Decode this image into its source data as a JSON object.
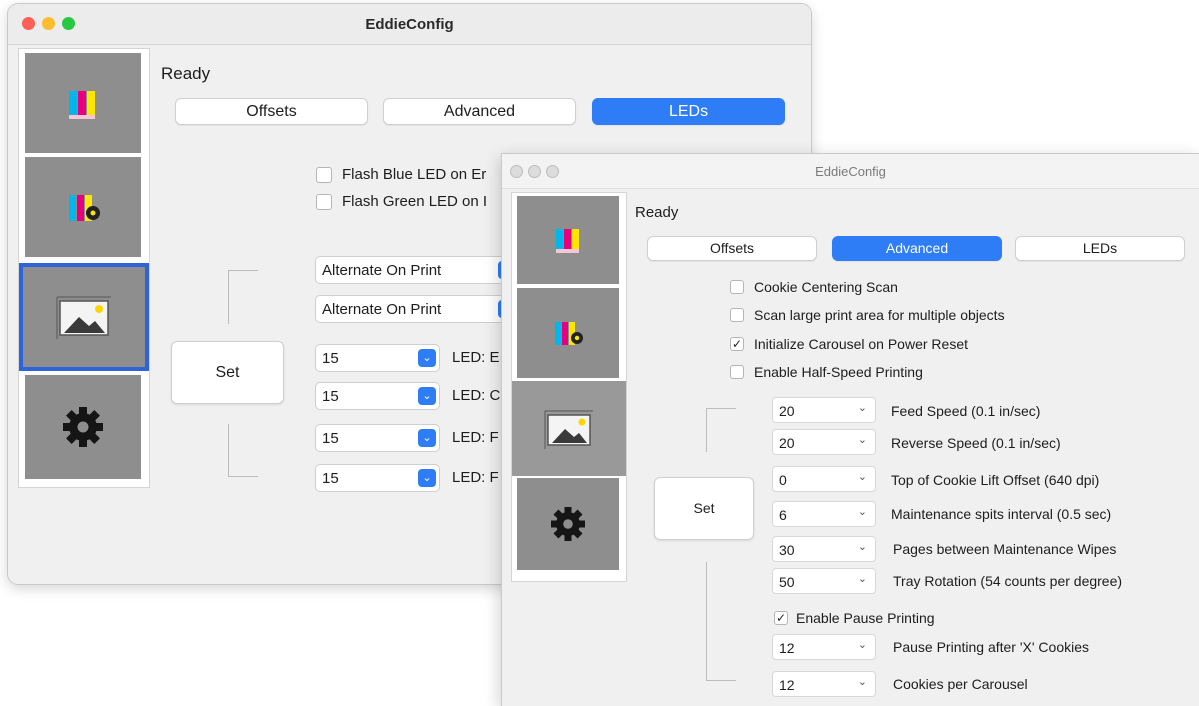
{
  "back_window": {
    "title": "EddieConfig",
    "status": "Ready",
    "tabs": [
      {
        "label": "Offsets",
        "active": false
      },
      {
        "label": "Advanced",
        "active": false
      },
      {
        "label": "LEDs",
        "active": true
      }
    ],
    "sidebar": [
      {
        "name": "color-bars-icon",
        "selected": false
      },
      {
        "name": "color-settings-icon",
        "selected": false
      },
      {
        "name": "print-area-icon",
        "selected": true
      },
      {
        "name": "gear-icon",
        "selected": false
      }
    ],
    "checkboxes": [
      {
        "label": "Flash Blue LED on Er",
        "checked": false
      },
      {
        "label": "Flash Green LED on I",
        "checked": false
      }
    ],
    "mode_selects": [
      "Alternate On Print",
      "Alternate On Print"
    ],
    "led_rows": [
      {
        "value": "15",
        "label": "LED: E"
      },
      {
        "value": "15",
        "label": "LED: C"
      },
      {
        "value": "15",
        "label": "LED: F"
      },
      {
        "value": "15",
        "label": "LED: F"
      }
    ],
    "set_label": "Set"
  },
  "front_window": {
    "title": "EddieConfig",
    "status": "Ready",
    "tabs": [
      {
        "label": "Offsets",
        "active": false
      },
      {
        "label": "Advanced",
        "active": true
      },
      {
        "label": "LEDs",
        "active": false
      }
    ],
    "checkboxes": [
      {
        "label": "Cookie Centering Scan",
        "checked": false
      },
      {
        "label": "Scan large print area for multiple objects",
        "checked": false
      },
      {
        "label": "Initialize Carousel on Power Reset",
        "checked": true
      },
      {
        "label": "Enable Half-Speed Printing",
        "checked": false
      }
    ],
    "settings": [
      {
        "value": "20",
        "label": "Feed Speed (0.1 in/sec)"
      },
      {
        "value": "20",
        "label": "Reverse Speed (0.1 in/sec)"
      },
      {
        "value": "0",
        "label": "Top of Cookie Lift Offset (640 dpi)"
      },
      {
        "value": "6",
        "label": "Maintenance spits interval (0.5 sec)"
      },
      {
        "value": "30",
        "label": "Pages between Maintenance Wipes"
      },
      {
        "value": "50",
        "label": "Tray Rotation (54 counts per degree)"
      }
    ],
    "pause_checkbox": {
      "label": "Enable Pause Printing",
      "checked": true
    },
    "pause_settings": [
      {
        "value": "12",
        "label": "Pause Printing after 'X' Cookies"
      },
      {
        "value": "12",
        "label": "Cookies per Carousel"
      }
    ],
    "set_label": "Set",
    "check_glyph": "✓",
    "arrow_glyph": "⌄"
  },
  "colors": {
    "accent": "#2e7cf6",
    "selection": "#2f63d9",
    "traffic_red": "#fe5f57",
    "traffic_yellow": "#febc2e",
    "traffic_green": "#28c840"
  }
}
